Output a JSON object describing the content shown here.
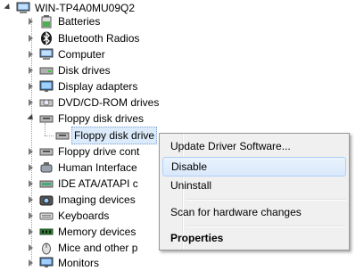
{
  "tree": {
    "root": "WIN-TP4A0MU09Q2",
    "items": [
      {
        "label": "Batteries",
        "icon": "battery-icon"
      },
      {
        "label": "Bluetooth Radios",
        "icon": "bluetooth-icon"
      },
      {
        "label": "Computer",
        "icon": "computer-icon"
      },
      {
        "label": "Disk drives",
        "icon": "disk-drive-icon"
      },
      {
        "label": "Display adapters",
        "icon": "display-adapter-icon"
      },
      {
        "label": "DVD/CD-ROM drives",
        "icon": "dvd-drive-icon"
      },
      {
        "label": "Floppy disk drives",
        "icon": "floppy-drive-icon"
      },
      {
        "label": "Floppy disk drive",
        "icon": "floppy-disk-icon"
      },
      {
        "label": "Floppy drive cont",
        "icon": "floppy-controller-icon"
      },
      {
        "label": "Human Interface",
        "icon": "human-interface-icon"
      },
      {
        "label": "IDE ATA/ATAPI c",
        "icon": "ide-controller-icon"
      },
      {
        "label": "Imaging devices",
        "icon": "camera-icon"
      },
      {
        "label": "Keyboards",
        "icon": "keyboard-icon"
      },
      {
        "label": "Memory devices",
        "icon": "memory-icon"
      },
      {
        "label": "Mice and other p",
        "icon": "mouse-icon"
      },
      {
        "label": "Monitors",
        "icon": "monitor-icon"
      }
    ]
  },
  "context_menu": {
    "items": [
      {
        "label": "Update Driver Software..."
      },
      {
        "label": "Disable"
      },
      {
        "label": "Uninstall"
      },
      {
        "label": "Scan for hardware changes"
      },
      {
        "label": "Properties"
      }
    ]
  },
  "colors": {
    "selection": "#dcebfc",
    "menu_background": "#f0f0f0",
    "menu_hover": "#d9e8fb"
  }
}
